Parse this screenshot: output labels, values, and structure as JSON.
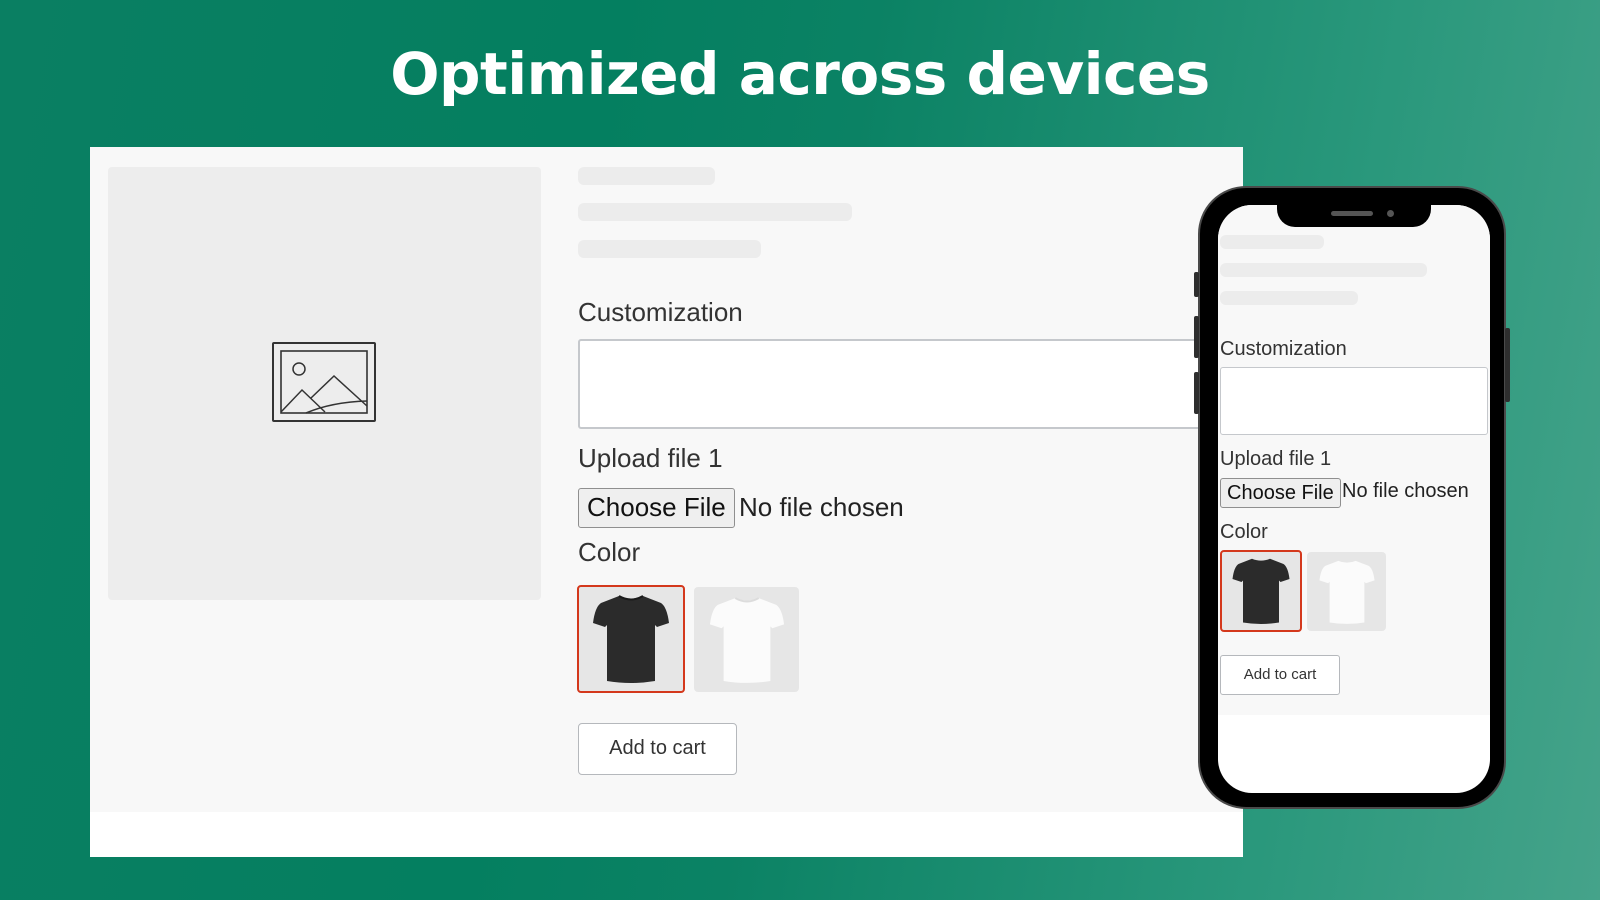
{
  "headline": "Optimized across devices",
  "colors": {
    "background_start": "#047f60",
    "background_end": "#45a38a",
    "selected_swatch_border": "#d4381c",
    "page_bg": "#f8f8f8"
  },
  "product_form": {
    "image_placeholder_icon": "image-placeholder-icon",
    "customization_label": "Customization",
    "customization_value": "",
    "upload_label": "Upload file 1",
    "choose_file_label": "Choose File",
    "file_status": "No file chosen",
    "color_label": "Color",
    "color_options": [
      {
        "name": "Black",
        "icon": "tshirt-black-icon",
        "selected": true
      },
      {
        "name": "White",
        "icon": "tshirt-white-icon",
        "selected": false
      }
    ],
    "add_to_cart_label": "Add to cart"
  }
}
